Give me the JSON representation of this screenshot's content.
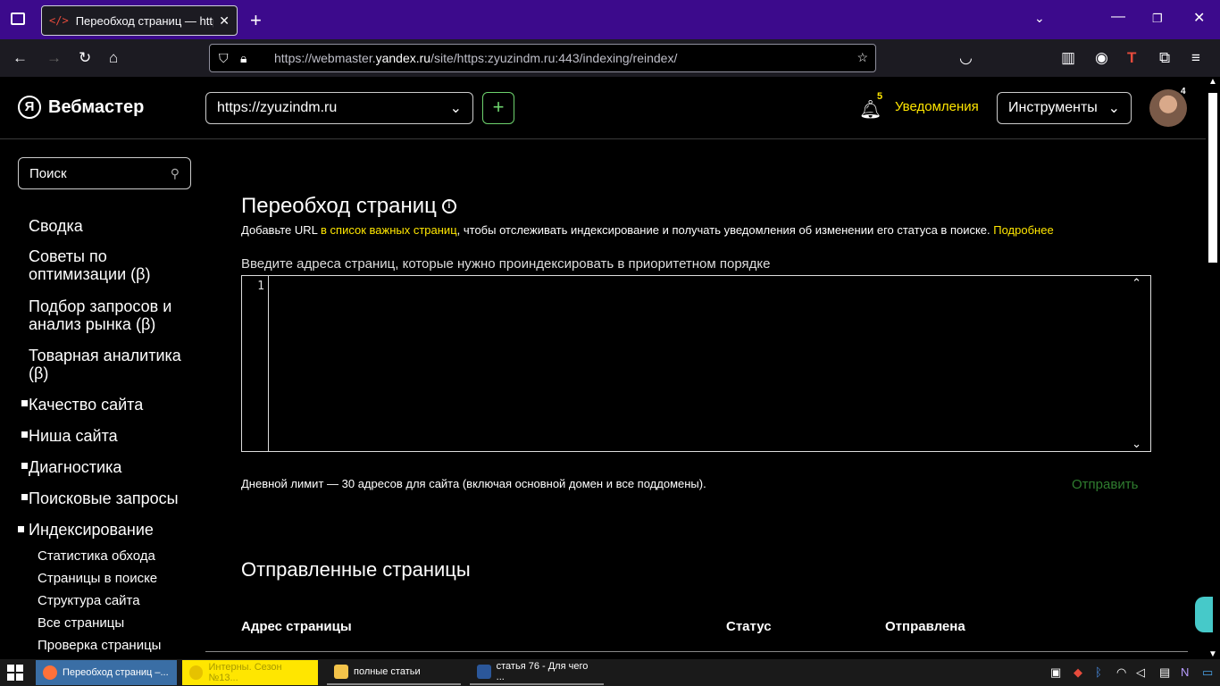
{
  "browser": {
    "tab_title": "Переобход страниц — https://",
    "tab_favicon": "</>",
    "url_dim_prefix": "https://webmaster.",
    "url_domain": "yandex.ru",
    "url_suffix": "/site/https:zyuzindm.ru:443/indexing/reindex/",
    "toolbar_letter": "T"
  },
  "header": {
    "logo_mark": "Я",
    "logo_text": "Вебмастер",
    "site": "https://zyuzindm.ru",
    "add": "+",
    "notif_count": "5",
    "notif_label": "Уведомления",
    "tools_label": "Инструменты",
    "avatar_count": "4"
  },
  "sidebar": {
    "search_placeholder": "Поиск",
    "items": [
      {
        "label": "Сводка"
      },
      {
        "label": "Советы по оптимизации (β)"
      },
      {
        "label": "Подбор запросов и анализ рынка (β)"
      },
      {
        "label": "Товарная аналитика (β)"
      },
      {
        "label": "Качество сайта"
      },
      {
        "label": "Ниша сайта"
      },
      {
        "label": "Диагностика"
      },
      {
        "label": "Поисковые запросы"
      },
      {
        "label": "Индексирование"
      }
    ],
    "subitems": [
      {
        "label": "Статистика обхода"
      },
      {
        "label": "Страницы в поиске"
      },
      {
        "label": "Структура сайта"
      },
      {
        "label": "Все страницы"
      },
      {
        "label": "Проверка страницы"
      }
    ]
  },
  "main": {
    "title": "Переобход страниц",
    "desc_1": "Добавьте URL",
    "desc_link": " в список важных страниц",
    "desc_2": ", чтобы отслеживать индексирование и получать уведомления об изменении его статуса в поиске. ",
    "desc_more": "Подробнее",
    "field_label": "Введите адреса страниц, которые нужно проиндексировать в приоритетном порядке",
    "line_number": "1",
    "limit_text": "Дневной лимит — 30 адресов для сайта (включая основной домен и все поддомены).",
    "send_label": "Отправить",
    "sent_title": "Отправленные страницы",
    "columns": [
      "Адрес страницы",
      "Статус",
      "Отправлена"
    ]
  },
  "taskbar": {
    "tasks": [
      {
        "label": "Переобход страниц –...",
        "color": "#ff7139"
      },
      {
        "label": "Интерны. Сезон №13...",
        "color": "#ffe600"
      },
      {
        "label": "полные статьи",
        "color": "#f3c34a"
      },
      {
        "label": "статья 76 - Для чего ...",
        "color": "#2b579a"
      }
    ]
  }
}
